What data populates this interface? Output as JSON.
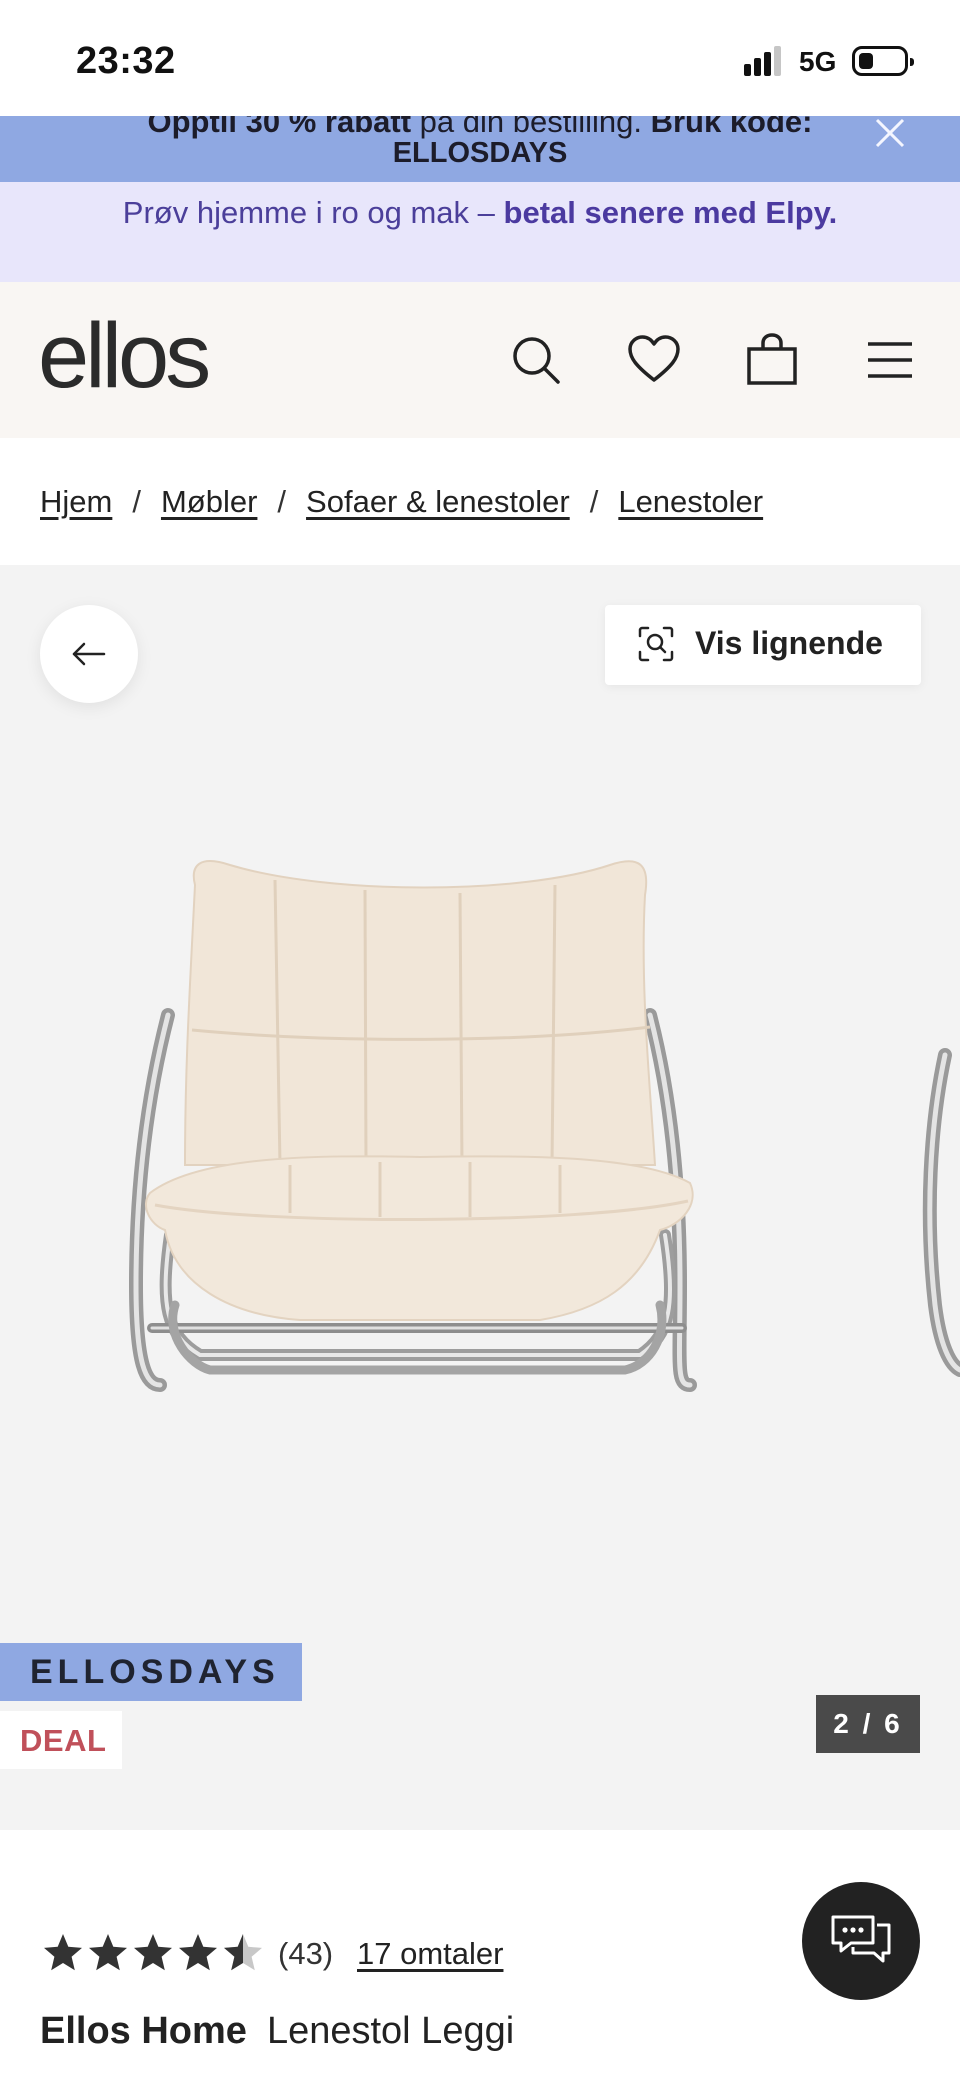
{
  "status_bar": {
    "time": "23:32",
    "network": "5G",
    "signal_bars_active": 3,
    "signal_bars_total": 4,
    "battery_level": 0.2
  },
  "promo_banner": {
    "line1_regular_a": "Opptil 30 % rabatt",
    "line1_light": " på din bestilling. ",
    "line1_bold": "Bruk kode:",
    "code": "ELLOSDAYS",
    "close_icon": "close-icon",
    "bg_color": "#8fa8e2"
  },
  "elpy_banner": {
    "text": "Prøv hjemme i ro og mak – ",
    "highlight": "betal senere med Elpy.",
    "bg_color": "#e8e6fb",
    "accent_color": "#4b3aa0"
  },
  "header": {
    "logo": "ellos",
    "icons": [
      "search-icon",
      "heart-icon",
      "shopping-bag-icon",
      "menu-icon"
    ]
  },
  "breadcrumb": {
    "items": [
      "Hjem",
      "Møbler",
      "Sofaer & lenestoler",
      "Lenestoler"
    ],
    "separator": "/"
  },
  "gallery": {
    "back_icon": "arrow-left-icon",
    "similar_label": "Vis lignende",
    "similar_icon": "visual-search-icon",
    "badge_campaign": "ELLOSDAYS",
    "badge_deal": "DEAL",
    "counter": "2 / 6",
    "current_image": 2,
    "total_images": 6
  },
  "product": {
    "rating": 4.5,
    "rating_count": "(43)",
    "reviews_label": "17 omtaler",
    "brand": "Ellos Home",
    "name": "Lenestol Leggi"
  },
  "chat": {
    "icon": "chat-bubbles-icon"
  }
}
